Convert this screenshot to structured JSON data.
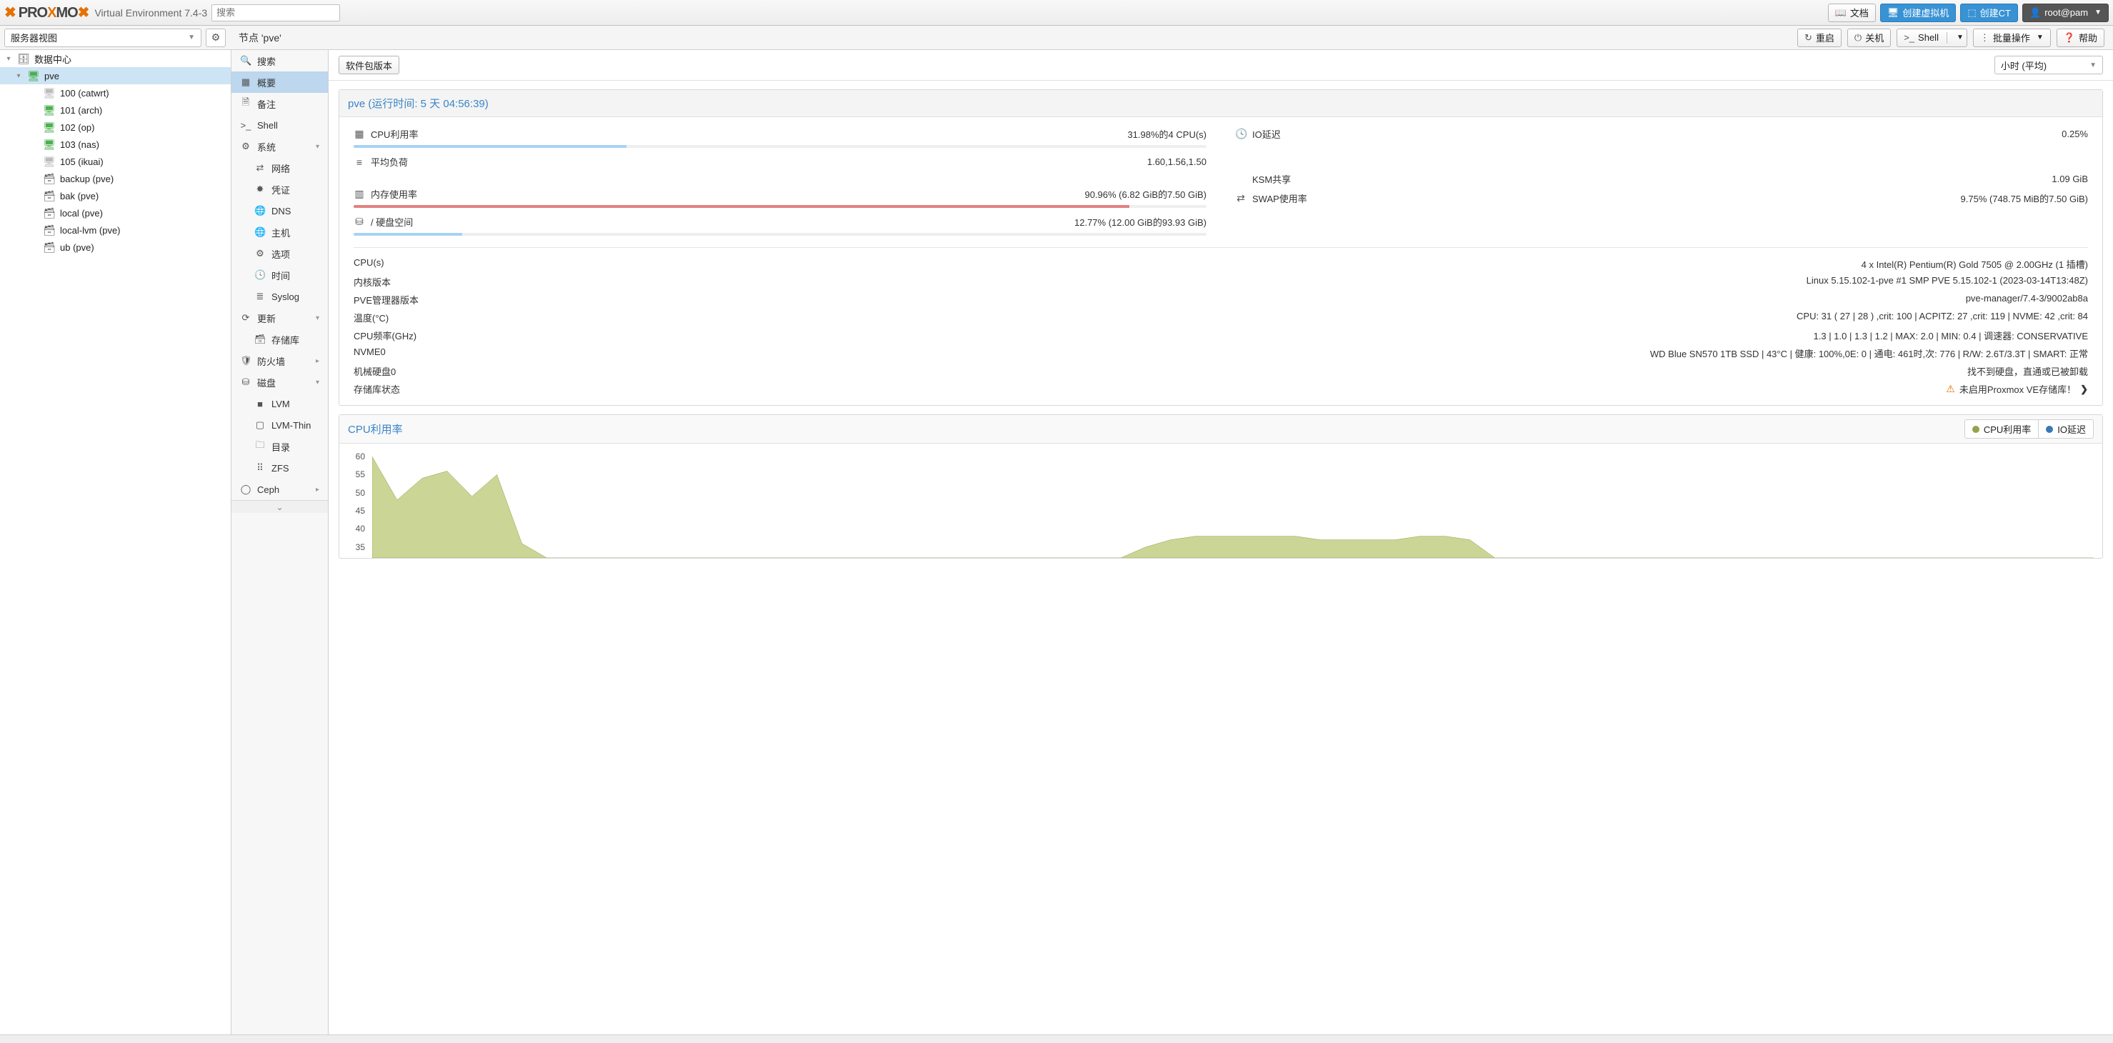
{
  "brand": {
    "part1": "PRO",
    "part2": "MO",
    "x": "X"
  },
  "version_label": "Virtual Environment 7.4-3",
  "search_placeholder": "搜索",
  "top_buttons": {
    "docs": "文档",
    "create_vm": "创建虚拟机",
    "create_ct": "创建CT",
    "user": "root@pam"
  },
  "view_selector": "服务器视图",
  "breadcrumb": "节点 'pve'",
  "node_toolbar": {
    "reboot": "重启",
    "shutdown": "关机",
    "shell": "Shell",
    "bulk": "批量操作",
    "help": "帮助"
  },
  "tree": [
    {
      "level": 0,
      "icon": "🗄",
      "label": "数据中心",
      "expander": "▾"
    },
    {
      "level": 1,
      "icon": "🖥",
      "label": "pve",
      "expander": "▾",
      "selected": true,
      "iconColor": "#4caf50"
    },
    {
      "level": 2,
      "icon": "🖥",
      "label": "100 (catwrt)",
      "iconColor": "#bbb"
    },
    {
      "level": 2,
      "icon": "🖥",
      "label": "101 (arch)",
      "iconColor": "#4caf50"
    },
    {
      "level": 2,
      "icon": "🖥",
      "label": "102 (op)",
      "iconColor": "#4caf50"
    },
    {
      "level": 2,
      "icon": "🖥",
      "label": "103 (nas)",
      "iconColor": "#4caf50"
    },
    {
      "level": 2,
      "icon": "🖥",
      "label": "105 (ikuai)",
      "iconColor": "#bbb"
    },
    {
      "level": 2,
      "icon": "🗃",
      "label": "backup (pve)"
    },
    {
      "level": 2,
      "icon": "🗃",
      "label": "bak (pve)"
    },
    {
      "level": 2,
      "icon": "🗃",
      "label": "local (pve)"
    },
    {
      "level": 2,
      "icon": "🗃",
      "label": "local-lvm (pve)"
    },
    {
      "level": 2,
      "icon": "🗃",
      "label": "ub (pve)"
    }
  ],
  "nav": [
    {
      "icon": "🔍",
      "label": "搜索"
    },
    {
      "icon": "▦",
      "label": "概要",
      "selected": true
    },
    {
      "icon": "🗎",
      "label": "备注"
    },
    {
      "icon": ">_",
      "label": "Shell"
    },
    {
      "icon": "⚙",
      "label": "系统",
      "expand": "▾"
    },
    {
      "icon": "⇄",
      "label": "网络",
      "sub": true
    },
    {
      "icon": "✸",
      "label": "凭证",
      "sub": true
    },
    {
      "icon": "🌐",
      "label": "DNS",
      "sub": true
    },
    {
      "icon": "🌐",
      "label": "主机",
      "sub": true
    },
    {
      "icon": "⚙",
      "label": "选项",
      "sub": true
    },
    {
      "icon": "🕓",
      "label": "时间",
      "sub": true
    },
    {
      "icon": "≣",
      "label": "Syslog",
      "sub": true
    },
    {
      "icon": "⟳",
      "label": "更新",
      "expand": "▾"
    },
    {
      "icon": "🗃",
      "label": "存储库",
      "sub": true
    },
    {
      "icon": "🛡",
      "label": "防火墙",
      "expand": "▸"
    },
    {
      "icon": "⛁",
      "label": "磁盘",
      "expand": "▾"
    },
    {
      "icon": "■",
      "label": "LVM",
      "sub": true
    },
    {
      "icon": "▢",
      "label": "LVM-Thin",
      "sub": true
    },
    {
      "icon": "🗀",
      "label": "目录",
      "sub": true
    },
    {
      "icon": "⠿",
      "label": "ZFS",
      "sub": true
    },
    {
      "icon": "◯",
      "label": "Ceph",
      "expand": "▸"
    }
  ],
  "content_buttons": {
    "pkg_versions": "软件包版本"
  },
  "time_range": "小时 (平均)",
  "summary_title": "pve (运行时间: 5 天 04:56:39)",
  "stats_left": [
    {
      "icon": "▦",
      "label": "CPU利用率",
      "value": "31.98%的4 CPU(s)",
      "bar": 31.98
    },
    {
      "icon": "≡",
      "label": "平均负荷",
      "value": "1.60,1.56,1.50"
    },
    {
      "spacer": true
    },
    {
      "icon": "▥",
      "label": "内存使用率",
      "value": "90.96% (6.82 GiB的7.50 GiB)",
      "bar": 90.96,
      "barColor": "red"
    },
    {
      "icon": "⛁",
      "label": "/ 硬盘空间",
      "value": "12.77% (12.00 GiB的93.93 GiB)",
      "bar": 12.77
    }
  ],
  "stats_right": [
    {
      "icon": "🕓",
      "label": "IO延迟",
      "value": "0.25%"
    },
    {
      "spacer": true
    },
    {
      "spacer": true
    },
    {
      "icon": "",
      "label": "KSM共享",
      "value": "1.09 GiB"
    },
    {
      "icon": "⇄",
      "label": "SWAP使用率",
      "value": "9.75% (748.75 MiB的7.50 GiB)"
    }
  ],
  "info_rows": [
    {
      "k": "CPU(s)",
      "v": "4 x Intel(R) Pentium(R) Gold 7505 @ 2.00GHz (1 插槽)"
    },
    {
      "k": "内核版本",
      "v": "Linux 5.15.102-1-pve #1 SMP PVE 5.15.102-1 (2023-03-14T13:48Z)"
    },
    {
      "k": "PVE管理器版本",
      "v": "pve-manager/7.4-3/9002ab8a"
    },
    {
      "k": "温度(°C)",
      "v": "CPU: 31 ( 27 | 28 ) ,crit: 100 | ACPITZ: 27 ,crit: 119 | NVME: 42 ,crit: 84"
    },
    {
      "k": "CPU频率(GHz)",
      "v": "1.3 | 1.0 | 1.3 | 1.2 | MAX: 2.0 | MIN: 0.4 | 调速器: CONSERVATIVE"
    },
    {
      "k": "NVME0",
      "v": "WD Blue SN570 1TB SSD | 43°C | 健康: 100%,0E: 0 | 通电: 461时,次: 776 | R/W: 2.6T/3.3T | SMART: 正常"
    },
    {
      "k": "机械硬盘0",
      "v": "找不到硬盘，直通或已被卸载"
    }
  ],
  "repo_status": {
    "k": "存储库状态",
    "v": "未启用Proxmox VE存储库！"
  },
  "chart": {
    "title": "CPU利用率",
    "legend": [
      {
        "label": "CPU利用率",
        "color": "#93a34a"
      },
      {
        "label": "IO延迟",
        "color": "#3b78b5"
      }
    ]
  },
  "chart_data": {
    "type": "line",
    "title": "CPU利用率",
    "ylabel": "%",
    "y_ticks": [
      60,
      55,
      50,
      45,
      40,
      35
    ],
    "ylim": [
      32,
      62
    ],
    "series": [
      {
        "name": "CPU利用率",
        "color": "#93a34a",
        "values": [
          60,
          48,
          54,
          56,
          49,
          55,
          36,
          32,
          32,
          32,
          32,
          32,
          32,
          32,
          32,
          32,
          32,
          32,
          32,
          32,
          32,
          32,
          32,
          32,
          32,
          32,
          32,
          32,
          32,
          32,
          32,
          35,
          37,
          38,
          38,
          38,
          38,
          38,
          37,
          37,
          37,
          37,
          38,
          38,
          37,
          32,
          32,
          32,
          32,
          32,
          32,
          32,
          32,
          32,
          32,
          32,
          32,
          32,
          32,
          32,
          32,
          32,
          32,
          32,
          32,
          32,
          32,
          32,
          32,
          32
        ]
      },
      {
        "name": "IO延迟",
        "color": "#3b78b5",
        "values": [
          32,
          32,
          32,
          32,
          32,
          32,
          32,
          32,
          32,
          32,
          32,
          32,
          32,
          32,
          32,
          32,
          32,
          32,
          32,
          32,
          32,
          32,
          32,
          32,
          32,
          32,
          32,
          32,
          32,
          32,
          32,
          32,
          32,
          32,
          32,
          32,
          32,
          32,
          32,
          32,
          32,
          32,
          32,
          32,
          32,
          32,
          32,
          32,
          32,
          32,
          32,
          32,
          32,
          32,
          32,
          32,
          32,
          32,
          32,
          32,
          32,
          32,
          32,
          32,
          32,
          32,
          32,
          32,
          32,
          32
        ]
      }
    ]
  }
}
